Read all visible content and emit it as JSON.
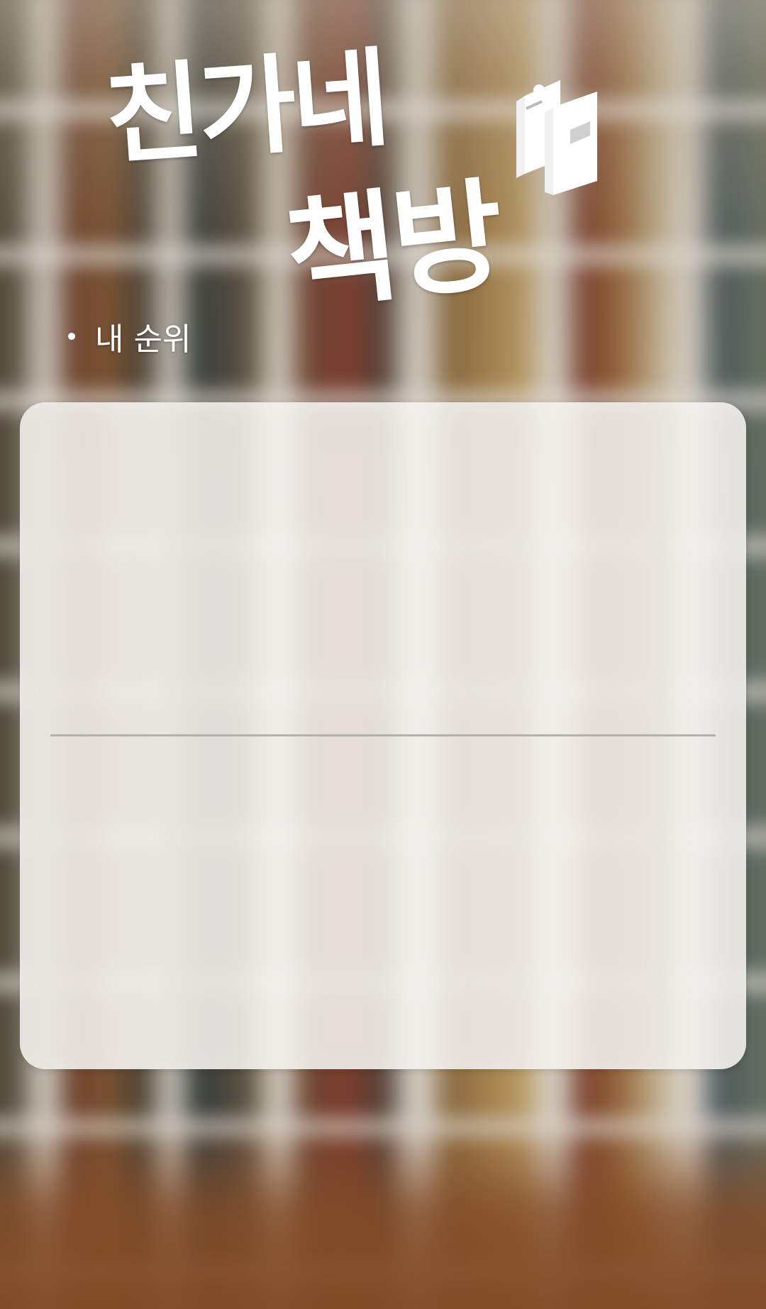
{
  "app": {
    "title_line1": "친가네",
    "title_line2": "책방"
  },
  "header": {
    "logo_icon": "books-icon",
    "my_rank_label": "내 순위"
  },
  "panel": {
    "top_section": {},
    "bottom_section": {}
  },
  "colors": {
    "text": "#ffffff",
    "panel_bg": "#f2f0ed",
    "divider": "#b3b1ae",
    "floor": "#8a4e26"
  }
}
